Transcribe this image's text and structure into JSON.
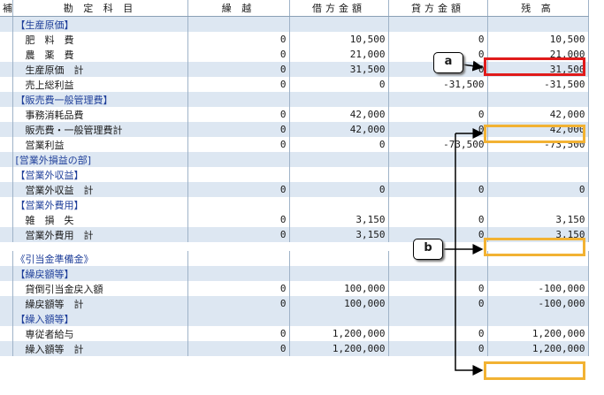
{
  "header": {
    "c0": "補",
    "name": "勘 定 科 目",
    "carry": "繰 越",
    "debit": "借方金額",
    "credit": "貸方金額",
    "balance": "残 高"
  },
  "rows": [
    {
      "name": "【生産原価】",
      "type": "hdr",
      "band": true
    },
    {
      "name": "肥　料　費",
      "carry": "0",
      "debit": "10,500",
      "credit": "0",
      "balance": "10,500",
      "band": false
    },
    {
      "name": "農　薬　費",
      "carry": "0",
      "debit": "21,000",
      "credit": "0",
      "balance": "21,000",
      "band": false
    },
    {
      "name": "生産原価　計",
      "carry": "0",
      "debit": "31,500",
      "credit": "0",
      "balance": "31,500",
      "band": true
    },
    {
      "name": "売上総利益",
      "carry": "0",
      "debit": "0",
      "credit": "-31,500",
      "balance": "-31,500",
      "band": false
    },
    {
      "name": "【販売費一般管理費】",
      "type": "hdr",
      "band": true
    },
    {
      "name": "事務消耗品費",
      "carry": "0",
      "debit": "42,000",
      "credit": "0",
      "balance": "42,000",
      "band": false
    },
    {
      "name": "販売費・一般管理費計",
      "carry": "0",
      "debit": "42,000",
      "credit": "0",
      "balance": "42,000",
      "band": true
    },
    {
      "name": "営業利益",
      "carry": "0",
      "debit": "0",
      "credit": "-73,500",
      "balance": "-73,500",
      "band": false
    },
    {
      "name": "[営業外損益の部]",
      "type": "hdr",
      "band": true
    },
    {
      "name": "【営業外収益】",
      "type": "hdr",
      "band": false
    },
    {
      "name": "営業外収益　計",
      "carry": "0",
      "debit": "0",
      "credit": "0",
      "balance": "0",
      "band": true
    },
    {
      "name": "【営業外費用】",
      "type": "hdr",
      "band": false
    },
    {
      "name": "雑　損　失",
      "carry": "0",
      "debit": "3,150",
      "credit": "0",
      "balance": "3,150",
      "band": false
    },
    {
      "name": "営業外費用　計",
      "carry": "0",
      "debit": "3,150",
      "credit": "0",
      "balance": "3,150",
      "band": true
    },
    {
      "type": "blank"
    },
    {
      "name": "《引当金準備金》",
      "type": "hdr",
      "band": false
    },
    {
      "name": "【繰戻額等】",
      "type": "hdr",
      "band": true
    },
    {
      "name": "貸倒引当金戻入額",
      "carry": "0",
      "debit": "100,000",
      "credit": "0",
      "balance": "-100,000",
      "band": false
    },
    {
      "name": "繰戻額等　計",
      "carry": "0",
      "debit": "100,000",
      "credit": "0",
      "balance": "-100,000",
      "band": true
    },
    {
      "name": "【繰入額等】",
      "type": "hdr",
      "band": true
    },
    {
      "name": "専従者給与",
      "carry": "0",
      "debit": "1,200,000",
      "credit": "0",
      "balance": "1,200,000",
      "band": false
    },
    {
      "name": "繰入額等　計",
      "carry": "0",
      "debit": "1,200,000",
      "credit": "0",
      "balance": "1,200,000",
      "band": true
    }
  ],
  "callouts": {
    "a": "a",
    "b": "b"
  },
  "colors": {
    "band": "#dde7f2",
    "red_highlight": "#e01b1b",
    "orange_highlight": "#f2b233",
    "header_text": "#1f3f9a"
  }
}
